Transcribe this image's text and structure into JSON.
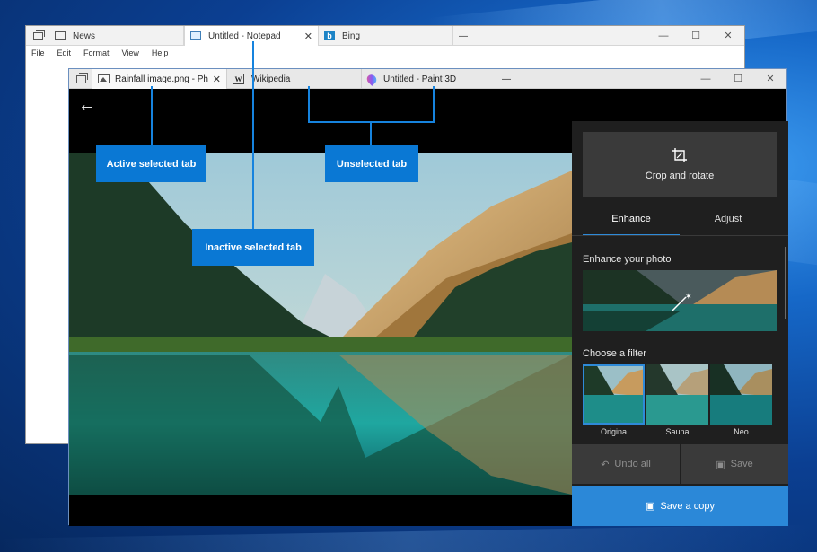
{
  "desktop": {
    "accent": "#0a78d4"
  },
  "back_window": {
    "tabs": [
      {
        "label": "News",
        "icon": "news-icon"
      },
      {
        "label": "Untitled - Notepad",
        "icon": "notepad-icon",
        "close": "✕"
      },
      {
        "label": "Bing",
        "icon": "bing-icon"
      }
    ],
    "controls": {
      "minimize": "—",
      "maximize": "☐",
      "close": "✕"
    },
    "menu": [
      "File",
      "Edit",
      "Format",
      "View",
      "Help"
    ]
  },
  "front_window": {
    "tabs": [
      {
        "label": "Rainfall image.png - Ph",
        "icon": "image-icon",
        "close": "✕"
      },
      {
        "label": "Wikipedia",
        "icon": "wikipedia-icon"
      },
      {
        "label": "Untitled - Paint 3D",
        "icon": "paint3d-icon"
      }
    ],
    "controls": {
      "minimize": "—",
      "maximize": "☐",
      "close": "✕"
    },
    "back_glyph": "←"
  },
  "edit_panel": {
    "crop_label": "Crop and rotate",
    "tabs": [
      "Enhance",
      "Adjust"
    ],
    "active_tab": "Enhance",
    "enhance_title": "Enhance your photo",
    "filter_title": "Choose a filter",
    "filters": [
      "Origina",
      "Sauna",
      "Neo"
    ],
    "undo_label": "Undo all",
    "save_label": "Save",
    "save_copy_label": "Save a copy"
  },
  "callouts": {
    "active": "Active selected tab",
    "inactive": "Inactive selected tab",
    "unselected": "Unselected tab"
  }
}
